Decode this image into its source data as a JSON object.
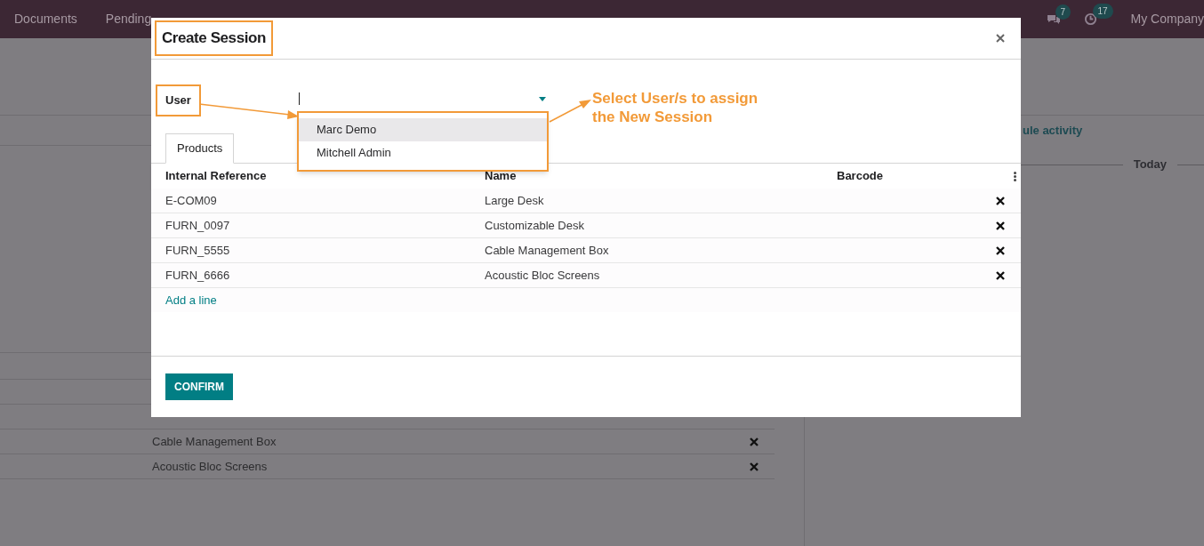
{
  "navbar": {
    "menu": [
      "Documents",
      "Pending"
    ],
    "chat_badge": "7",
    "activity_badge": "17",
    "company": "My Company"
  },
  "background": {
    "activity_link": "ule activity",
    "divider_label": "Today",
    "rows": [
      "Cable Management Box",
      "Acoustic Bloc Screens"
    ]
  },
  "dialog": {
    "title": "Create Session",
    "field_label": "User",
    "options": [
      {
        "label": "Marc Demo",
        "selected": true
      },
      {
        "label": "Mitchell Admin",
        "selected": false
      }
    ],
    "tabs": [
      {
        "label": "Products",
        "selected": true
      }
    ],
    "columns": [
      "Internal Reference",
      "Name",
      "Barcode"
    ],
    "rows": [
      [
        "E-COM09",
        "Large Desk"
      ],
      [
        "FURN_0097",
        "Customizable Desk"
      ],
      [
        "FURN_5555",
        "Cable Management Box"
      ],
      [
        "FURN_6666",
        "Acoustic Bloc Screens"
      ]
    ],
    "add_line": "Add a line",
    "confirm": "CONFIRM"
  },
  "annotation": [
    "Select User/s to assign",
    "the New Session"
  ]
}
